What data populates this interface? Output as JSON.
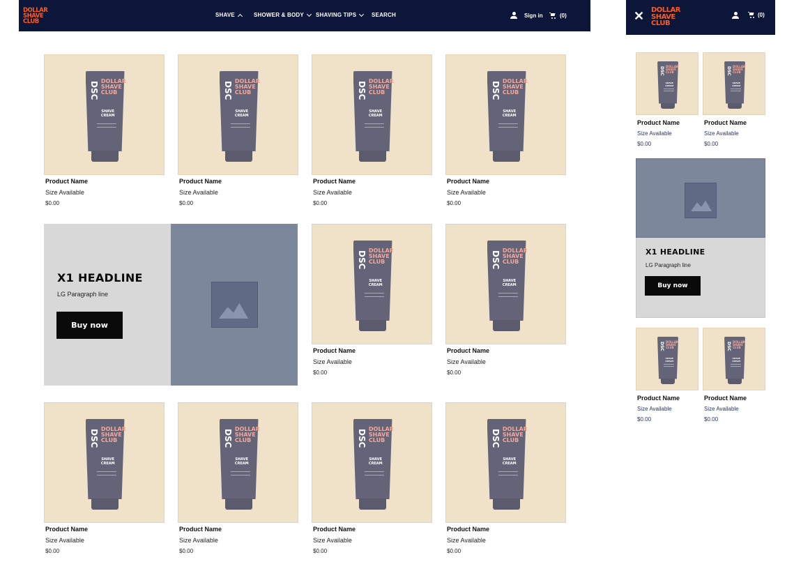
{
  "brand": {
    "logo_lines": [
      "DOLLAR",
      "SHAVE",
      "CLUB"
    ],
    "color": "#ff5a1f"
  },
  "header": {
    "nav": [
      {
        "label": "SHAVE"
      },
      {
        "label": "SHOWER & BODY"
      },
      {
        "label": "SHAVING TIPS"
      },
      {
        "label": "SEARCH"
      }
    ],
    "sign_in": "Sign in",
    "cart_count": "(0)"
  },
  "product": {
    "dsc": "DSC",
    "brand_lines": [
      "DOLLAR",
      "SHAVE",
      "CLUB"
    ],
    "type_lines": [
      "SHAVE",
      "CREAM"
    ]
  },
  "grid": {
    "products": [
      {
        "name": "Product Name",
        "size": "Size Available",
        "price": "$0.00"
      },
      {
        "name": "Product Name",
        "size": "Size Available",
        "price": "$0.00"
      },
      {
        "name": "Product Name",
        "size": "Size Available",
        "price": "$0.00"
      },
      {
        "name": "Product Name",
        "size": "Size Available",
        "price": "$0.00"
      },
      {
        "name": "Product Name",
        "size": "Size Available",
        "price": "$0.00"
      },
      {
        "name": "Product Name",
        "size": "Size Available",
        "price": "$0.00"
      },
      {
        "name": "Product Name",
        "size": "Size Available",
        "price": "$0.00"
      },
      {
        "name": "Product Name",
        "size": "Size Available",
        "price": "$0.00"
      },
      {
        "name": "Product Name",
        "size": "Size Available",
        "price": "$0.00"
      },
      {
        "name": "Product Name",
        "size": "Size Available",
        "price": "$0.00"
      }
    ]
  },
  "hero": {
    "headline": "X1 HEADLINE",
    "paragraph": "LG Paragraph line",
    "button": "Buy now"
  },
  "mobile": {
    "cart_count": "(0)",
    "products": [
      {
        "name": "Product Name",
        "size": "Size Available",
        "price": "$0.00"
      },
      {
        "name": "Product Name",
        "size": "Size Available",
        "price": "$0.00"
      },
      {
        "name": "Product Name",
        "size": "Size Available",
        "price": "$0.00"
      },
      {
        "name": "Product Name",
        "size": "Size Available",
        "price": "$0.00"
      }
    ],
    "hero": {
      "headline": "X1 HEADLINE",
      "paragraph": "LG Paragraph line",
      "button": "Buy now"
    }
  },
  "colors": {
    "nav_bg": "#0b1638",
    "tile_bg": "#f0e1c9",
    "tube": "#646478",
    "hero_gray": "#d8d8d8",
    "hero_slate": "#7c879b",
    "button": "#0a0a0a"
  }
}
